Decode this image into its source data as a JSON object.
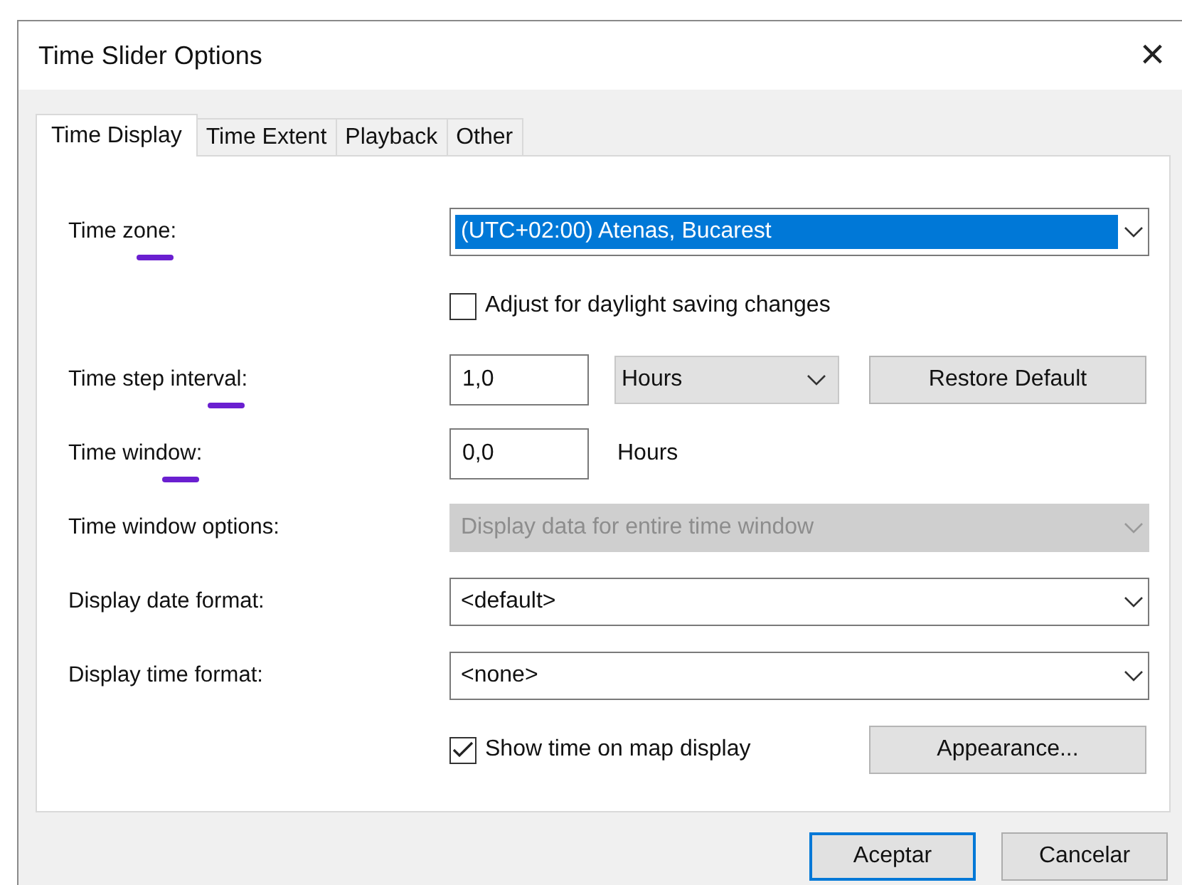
{
  "window": {
    "title": "Time Slider Options",
    "close": "×"
  },
  "tabs": [
    {
      "label": "Time Display",
      "selected": true
    },
    {
      "label": "Time Extent",
      "selected": false
    },
    {
      "label": "Playback",
      "selected": false
    },
    {
      "label": "Other",
      "selected": false
    }
  ],
  "rows": [
    {
      "label": "Time zone:",
      "marked": true,
      "controls": [
        {
          "kind": "combo",
          "value": "(UTC+02:00) Atenas, Bucarest",
          "selected": true,
          "disabled": false
        }
      ]
    },
    {
      "controls": [
        {
          "kind": "checkbox",
          "label": "Adjust for daylight saving changes",
          "checked": false
        }
      ]
    },
    {
      "label": "Time step interval:",
      "marked": true,
      "controls": [
        {
          "kind": "input",
          "value": "1,0"
        },
        {
          "kind": "dropdown",
          "value": "Hours"
        },
        {
          "kind": "button",
          "label": "Restore Default"
        }
      ]
    },
    {
      "label": "Time window:",
      "marked": true,
      "controls": [
        {
          "kind": "input",
          "value": "0,0"
        },
        {
          "kind": "text",
          "text": "Hours"
        }
      ]
    },
    {
      "label": "Time window options:",
      "marked": false,
      "controls": [
        {
          "kind": "combo",
          "value": "Display data for entire time window",
          "selected": false,
          "disabled": true
        }
      ]
    },
    {
      "label": "Display date format:",
      "marked": false,
      "controls": [
        {
          "kind": "combo",
          "value": "<default>",
          "selected": false,
          "disabled": false
        }
      ]
    },
    {
      "label": "Display time format:",
      "marked": false,
      "controls": [
        {
          "kind": "combo",
          "value": "<none>",
          "selected": false,
          "disabled": false
        }
      ]
    },
    {
      "controls": [
        {
          "kind": "checkbox",
          "label": "Show time on map display",
          "checked": true
        },
        {
          "kind": "button",
          "label": "Appearance..."
        }
      ]
    }
  ],
  "buttons": [
    {
      "label": "Aceptar",
      "selected": true
    },
    {
      "label": "Cancelar",
      "selected": false
    }
  ]
}
